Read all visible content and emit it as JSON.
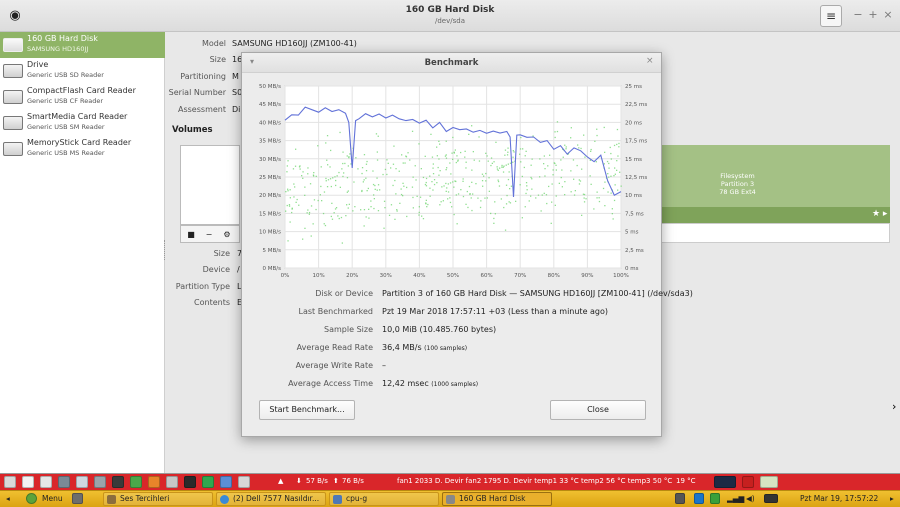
{
  "window": {
    "title": "160 GB Hard Disk",
    "subtitle": "/dev/sda",
    "menu_glyph": "≡",
    "minimize": "−",
    "maximize": "+",
    "close": "×",
    "disk_glyph": "◉"
  },
  "sidebar": {
    "items": [
      {
        "name": "160 GB Hard Disk",
        "sub": "SAMSUNG HD160JJ",
        "selected": true
      },
      {
        "name": "Drive",
        "sub": "Generic USB SD Reader"
      },
      {
        "name": "CompactFlash Card Reader",
        "sub": "Generic USB CF Reader"
      },
      {
        "name": "SmartMedia Card Reader",
        "sub": "Generic USB SM Reader"
      },
      {
        "name": "MemoryStick Card Reader",
        "sub": "Generic USB MS Reader"
      }
    ]
  },
  "drive_info": {
    "rows": [
      {
        "label": "Model",
        "value": "SAMSUNG HD160JJ (ZM100-41)"
      },
      {
        "label": "Size",
        "value": "16"
      },
      {
        "label": "Partitioning",
        "value": "M"
      },
      {
        "label": "Serial Number",
        "value": "S0"
      },
      {
        "label": "Assessment",
        "value": "Di"
      }
    ]
  },
  "volumes": {
    "title": "Volumes",
    "partition_lines": [
      "Filesystem",
      "Partition 3",
      "78 GB Ext4"
    ],
    "star": "★ ▸",
    "tools": [
      "■",
      "−",
      "⚙"
    ],
    "rows": [
      {
        "label": "Size",
        "value": "7"
      },
      {
        "label": "Device",
        "value": "/"
      },
      {
        "label": "Partition Type",
        "value": "L"
      },
      {
        "label": "Contents",
        "value": "E"
      }
    ]
  },
  "dialog": {
    "title": "Benchmark",
    "caret": "▾",
    "close": "×",
    "info": [
      {
        "label": "Disk or Device",
        "value": "Partition 3 of 160 GB Hard Disk — SAMSUNG HD160JJ [ZM100-41] (/dev/sda3)"
      },
      {
        "label": "Last Benchmarked",
        "value": "Pzt 19 Mar 2018 17:57:11 +03 (Less than a minute ago)"
      },
      {
        "label": "Sample Size",
        "value": "10,0 MiB (10.485.760 bytes)"
      },
      {
        "label": "Average Read Rate",
        "value": "36,4 MB/s",
        "note": "(100 samples)"
      },
      {
        "label": "Average Write Rate",
        "value": "–"
      },
      {
        "label": "Average Access Time",
        "value": "12,42 msec",
        "note": "(1000 samples)"
      }
    ],
    "start_button": "Start Benchmark...",
    "close_button": "Close"
  },
  "chart_data": {
    "type": "line",
    "x_ticks": [
      "0%",
      "10%",
      "20%",
      "30%",
      "40%",
      "50%",
      "60%",
      "70%",
      "80%",
      "90%",
      "100%"
    ],
    "y_left_ticks": [
      "50 MB/s",
      "45 MB/s",
      "40 MB/s",
      "35 MB/s",
      "30 MB/s",
      "25 MB/s",
      "20 MB/s",
      "15 MB/s",
      "10 MB/s",
      "5 MB/s",
      "0 MB/s"
    ],
    "y_right_ticks": [
      "25 ms",
      "22,5 ms",
      "20 ms",
      "17,5 ms",
      "15 ms",
      "12,5 ms",
      "10 ms",
      "7,5 ms",
      "5 ms",
      "2,5 ms",
      "0 ms"
    ],
    "xlim": [
      0,
      100
    ],
    "ylim": [
      0,
      50
    ],
    "grid": true,
    "series": [
      {
        "color": "#6272d8",
        "x": [
          0,
          2,
          4,
          6,
          8,
          10,
          12,
          14,
          16,
          18,
          19,
          20,
          21,
          22,
          24,
          26,
          28,
          30,
          32,
          34,
          36,
          38,
          40,
          42,
          44,
          46,
          48,
          50,
          52,
          54,
          56,
          58,
          60,
          62,
          64,
          66,
          67,
          68,
          69,
          70,
          72,
          74,
          76,
          78,
          80,
          82,
          84,
          86,
          88,
          90,
          92,
          94,
          96,
          98,
          100
        ],
        "y": [
          40.6,
          42.1,
          42.0,
          44.2,
          43.5,
          42.8,
          44.0,
          43.0,
          43.5,
          42.5,
          40.0,
          27.5,
          40.5,
          41.0,
          42.4,
          41.5,
          42.3,
          41.2,
          42.0,
          41.0,
          40.5,
          40.8,
          39.8,
          40.6,
          38.5,
          40.0,
          37.5,
          38.6,
          38.0,
          38.2,
          37.3,
          37.8,
          37.0,
          37.6,
          37.1,
          37.5,
          36.0,
          19.5,
          36.5,
          36.6,
          35.9,
          36.0,
          34.5,
          35.0,
          32.6,
          33.6,
          31.3,
          33.0,
          32.2,
          30.5,
          29.2,
          31.0,
          24.0,
          20.0,
          21.0
        ]
      }
    ],
    "access_time_samples": 1000,
    "access_time_color": "#6bd36b"
  },
  "top_panel": {
    "net_down": "57 B/s",
    "net_up": "76 B/s",
    "sensors": "fan1 2033 D. Devir fan2 1795 D. Devir temp1 33 °C temp2 56 °C temp3 50 °C",
    "temp": "19 °C"
  },
  "bottom_panel": {
    "menu_label": "Menu",
    "tasks": [
      {
        "label": "Ses Tercihleri",
        "color": "#8b6d3d"
      },
      {
        "label": "(2) Dell 7577 Nasıldır...",
        "color": "#3a8ad6"
      },
      {
        "label": "cpu-g",
        "color": "#4f78b5"
      },
      {
        "label": "160 GB Hard Disk",
        "color": "#888888",
        "active": true
      }
    ],
    "clock": "Pzt Mar 19, 17:57:22"
  },
  "colors": {
    "selection_green": "#8fb466",
    "partition_green": "#a4c185",
    "top_panel_red": "#d9262a",
    "bottom_panel_yellow": "#e8b424",
    "read_line": "#6272d8",
    "access_points": "#6bd36b"
  }
}
